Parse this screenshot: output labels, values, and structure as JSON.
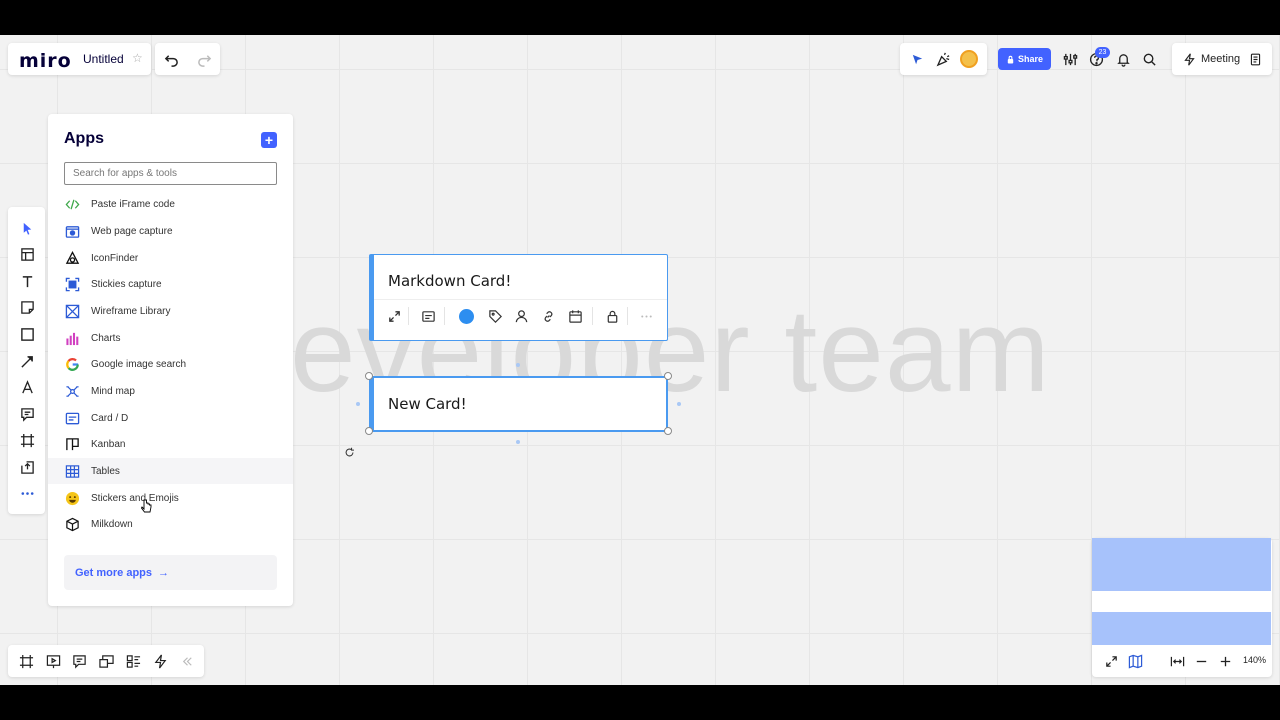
{
  "app": {
    "logo": "miro",
    "board_title": "Untitled",
    "star": "☆"
  },
  "toolbar_top": {
    "undo_icon": "undo-icon",
    "redo_icon": "redo-icon",
    "share_label": "Share",
    "notifications_count": "23",
    "meeting_label": "Meeting"
  },
  "canvas": {
    "watermark": "eveloper team",
    "cards": [
      {
        "title": "Markdown Card!"
      },
      {
        "title": "New Card!"
      }
    ],
    "card_toolbar": {
      "icons": [
        "expand-icon",
        "card-icon",
        "color-icon",
        "tag-icon",
        "assignee-icon",
        "link-icon",
        "calendar-icon",
        "lock-icon",
        "more-icon"
      ],
      "accent": "#2d8ef0"
    }
  },
  "apps_panel": {
    "title": "Apps",
    "search_placeholder": "Search for apps & tools",
    "items": [
      {
        "label": "Paste iFrame code",
        "icon": "code-icon",
        "color": "#3ea84a"
      },
      {
        "label": "Web page capture",
        "icon": "camera-icon",
        "color": "#2d5bd6"
      },
      {
        "label": "IconFinder",
        "icon": "iconfinder-icon",
        "color": "#111111"
      },
      {
        "label": "Stickies capture",
        "icon": "capture-icon",
        "color": "#2d5bd6"
      },
      {
        "label": "Wireframe Library",
        "icon": "wireframe-icon",
        "color": "#2d5bd6"
      },
      {
        "label": "Charts",
        "icon": "chart-icon",
        "color": "#d13fc0"
      },
      {
        "label": "Google image search",
        "icon": "google-icon",
        "color": "#4285f4"
      },
      {
        "label": "Mind map",
        "icon": "mindmap-icon",
        "color": "#2d5bd6"
      },
      {
        "label": "Card / D",
        "icon": "card-icon",
        "color": "#2d5bd6"
      },
      {
        "label": "Kanban",
        "icon": "kanban-icon",
        "color": "#111111"
      },
      {
        "label": "Tables",
        "icon": "table-icon",
        "color": "#2d5bd6"
      },
      {
        "label": "Stickers and Emojis",
        "icon": "emoji-icon",
        "color": "#f5c518"
      },
      {
        "label": "Milkdown",
        "icon": "cube-icon",
        "color": "#111111"
      }
    ],
    "get_more_label": "Get more apps",
    "get_more_arrow": "→"
  },
  "zoom": {
    "level": "140%"
  },
  "colors": {
    "accent": "#4262ff",
    "card_border": "#4a9af0",
    "minimap_block": "#a7c2fb"
  }
}
